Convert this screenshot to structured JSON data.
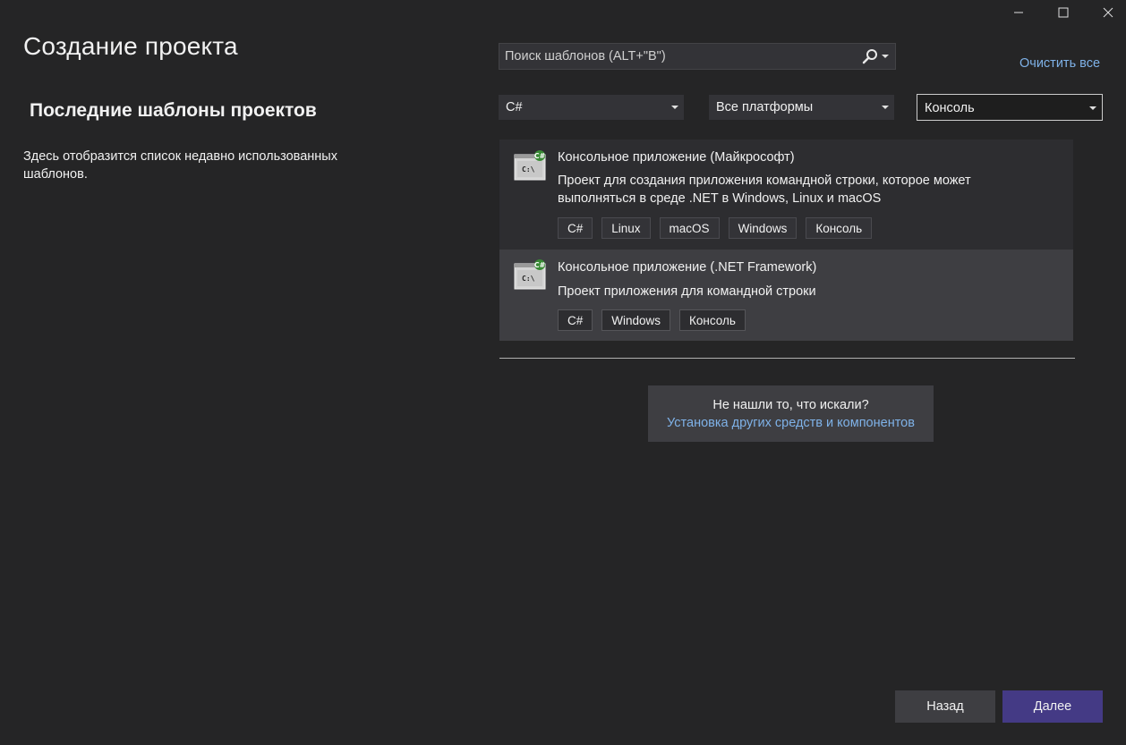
{
  "window": {
    "minimize_icon": "minimize-icon",
    "maximize_icon": "maximize-icon",
    "close_icon": "close-icon"
  },
  "title": "Создание проекта",
  "recent": {
    "heading": "Последние шаблоны проектов",
    "description": "Здесь отобразится список недавно использованных шаблонов."
  },
  "search": {
    "placeholder": "Поиск шаблонов (ALT+\"В\")",
    "icon": "search-icon"
  },
  "clear_all": "Очистить все",
  "filters": {
    "language": "C#",
    "platform": "Все платформы",
    "project_type": "Консоль"
  },
  "templates": [
    {
      "name": "Консольное приложение (Майкрософт)",
      "description": "Проект для создания приложения командной строки, которое может выполняться в среде .NET в Windows, Linux и macOS",
      "icon": "csharp-console-icon",
      "badge": "C#",
      "icon_text": "C:\\",
      "tags": [
        "C#",
        "Linux",
        "macOS",
        "Windows",
        "Консоль"
      ]
    },
    {
      "name": "Консольное приложение (.NET Framework)",
      "description": "Проект приложения для командной строки",
      "icon": "csharp-console-icon",
      "badge": "C#",
      "icon_text": "C:\\",
      "tags": [
        "C#",
        "Windows",
        "Консоль"
      ]
    }
  ],
  "not_found": {
    "question": "Не нашли то, что искали?",
    "link": "Установка других средств и компонентов"
  },
  "buttons": {
    "back": "Назад",
    "next": "Далее"
  },
  "colors": {
    "background": "#252526",
    "link": "#7fb2e8",
    "primary_button": "#443a85",
    "selected_item": "#3e3e42",
    "csharp_badge": "#388a34"
  }
}
